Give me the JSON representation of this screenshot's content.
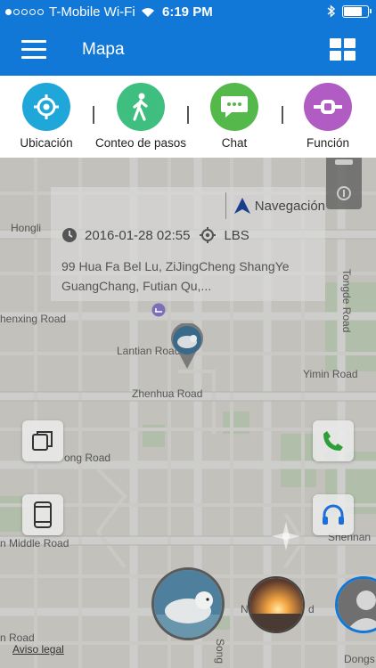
{
  "status_bar": {
    "carrier": "T-Mobile Wi-Fi",
    "time": "6:19 PM",
    "battery_level": 0.7
  },
  "app_bar": {
    "title": "Mapa",
    "menu_icon": "hamburger-menu-icon",
    "grid_icon": "grid-icon"
  },
  "functions": [
    {
      "label": "Ubicación",
      "icon": "locate-crosshair-icon",
      "color": "#1ea7d8"
    },
    {
      "label": "Conteo de pasos",
      "icon": "walking-person-icon",
      "color": "#3fbf7f"
    },
    {
      "label": "Chat",
      "icon": "chat-bubble-icon",
      "color": "#54b84a"
    },
    {
      "label": "Función",
      "icon": "band-icon",
      "color": "#b05cc2"
    }
  ],
  "info_card": {
    "navigation_label": "Navegación",
    "datetime": "2016-01-28 02:55",
    "location_type": "LBS",
    "address": "99 Hua Fa Bel Lu, ZiJingCheng ShangYe GuangChang, Futian Qu,..."
  },
  "map_labels": {
    "hongli": "Hongli",
    "tongde_road": "Tongde Road",
    "henxing_road": "henxing Road",
    "lantian_road": "Lantian Road",
    "yimin_road": "Yimin Road",
    "zhenhua_road": "Zhenhua Road",
    "ong_road": "ong Road",
    "middle_road": "n Middle Road",
    "shennan": "Shennan",
    "n_road": "N",
    "road_suffix": "d",
    "bottom_road": "n Road",
    "song": "Song",
    "dongs": "Dongs"
  },
  "legal_link": "Aviso legal",
  "colors": {
    "primary": "#1178d8",
    "call_green": "#2e9e3a",
    "headset_blue": "#1b6fd6",
    "nav_arrow": "#1a3f8f"
  }
}
